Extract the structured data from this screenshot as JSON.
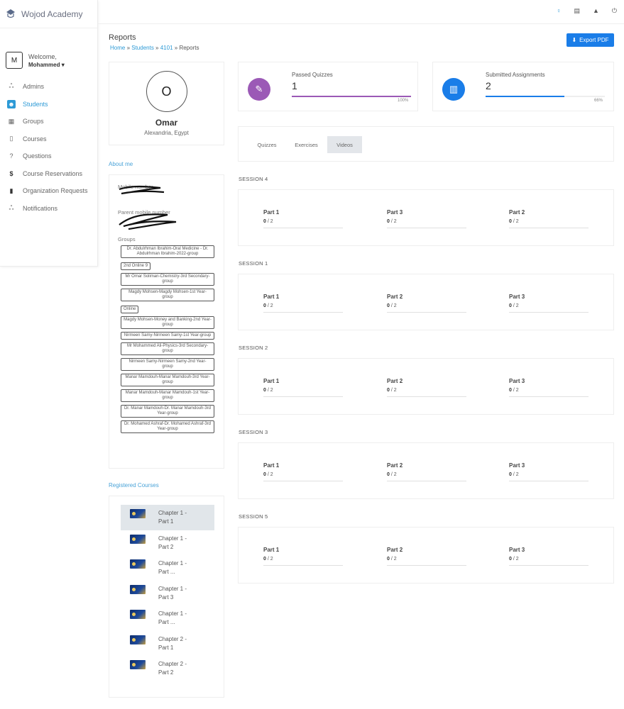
{
  "app": {
    "name": "Wojod Academy",
    "welcome_label": "Welcome,",
    "user_name": "Mohammed",
    "user_initial": "M"
  },
  "sidebar": {
    "items": [
      {
        "label": "Admins",
        "icon": "users-icon"
      },
      {
        "label": "Students",
        "icon": "students-icon",
        "active": true
      },
      {
        "label": "Groups",
        "icon": "grid-icon"
      },
      {
        "label": "Courses",
        "icon": "book-icon"
      },
      {
        "label": "Questions",
        "icon": "question-icon"
      },
      {
        "label": "Course Reservations",
        "icon": "dollar-icon"
      },
      {
        "label": "Organization Requests",
        "icon": "bookmark-icon"
      },
      {
        "label": "Notifications",
        "icon": "users-icon"
      }
    ]
  },
  "header": {
    "title": "Reports",
    "breadcrumb": [
      "Home",
      "Students",
      "4101",
      "Reports"
    ],
    "export_label": "Export PDF"
  },
  "profile": {
    "initial": "O",
    "name": "Omar",
    "location": "Alexandria, Egypt"
  },
  "about": {
    "label": "About me",
    "mobile_label": "Mobile number",
    "parent_label": "Parent mobile number",
    "groups_label": "Groups",
    "groups": [
      "Dr. Abdulrhman Ibrahim-Oral Medicine - Dr. Abdulrhman Ibrahim-2022-group",
      "2nd Online 9",
      "Mr Omar Soliman-Chemistry-3rd Secondary-group",
      "Magdy Mohsen-Magdy Mohsen-1st Year-group",
      "Online",
      "Magdy Mohsen-Money and Banking-2nd Year-group",
      "Nirmeen Samy-Nirmeen Samy-1st Year-group",
      "Mr Mohammed Ali-Physics-3rd Secondary-group",
      "Nirmeen Samy-Nirmeen Samy-2nd Year-group",
      "Manar Mamdouh-Manar Mamdouh-3rd Year-group",
      "Manar Mamdouh-Manar Mamdouh-1st Year-group",
      "Dr. Manar Mamdouh-Dr. Manar Mamdouh-3rd Year-group",
      "Dr. Mohamed Ashraf-Dr. Mohamed Ashraf-3rd Year-group"
    ]
  },
  "courses": {
    "label": "Registered Courses",
    "items": [
      {
        "line1": "Chapter 1 -",
        "line2": "Part 1",
        "active": true
      },
      {
        "line1": "Chapter 1 -",
        "line2": "Part 2"
      },
      {
        "line1": "Chapter 1 -",
        "line2": "Part ..."
      },
      {
        "line1": "Chapter 1 -",
        "line2": "Part 3"
      },
      {
        "line1": "Chapter 1 -",
        "line2": "Part ..."
      },
      {
        "line1": "Chapter 2 -",
        "line2": "Part 1"
      },
      {
        "line1": "Chapter 2 -",
        "line2": "Part 2"
      }
    ]
  },
  "stats": {
    "quizzes": {
      "label": "Passed Quizzes",
      "value": "1",
      "pct_label": "100%",
      "pct": 1.0,
      "color": "#9b59b6"
    },
    "assignments": {
      "label": "Submitted Assignments",
      "value": "2",
      "pct_label": "66%",
      "pct": 0.66,
      "color": "#1a7de8"
    }
  },
  "tabs": [
    {
      "label": "Quizzes"
    },
    {
      "label": "Exercises"
    },
    {
      "label": "Videos",
      "active": true
    }
  ],
  "sessions": [
    {
      "title": "SESSION 4",
      "parts": [
        {
          "name": "Part 1",
          "score": "0",
          "total": "/ 2"
        },
        {
          "name": "Part 3",
          "score": "0",
          "total": "/ 2"
        },
        {
          "name": "Part 2",
          "score": "0",
          "total": "/ 2"
        }
      ]
    },
    {
      "title": "SESSION 1",
      "parts": [
        {
          "name": "Part 1",
          "score": "0",
          "total": "/ 2"
        },
        {
          "name": "Part 2",
          "score": "0",
          "total": "/ 2"
        },
        {
          "name": "Part 3",
          "score": "0",
          "total": "/ 2"
        }
      ]
    },
    {
      "title": "SESSION 2",
      "parts": [
        {
          "name": "Part 1",
          "score": "0",
          "total": "/ 2"
        },
        {
          "name": "Part 2",
          "score": "0",
          "total": "/ 2"
        },
        {
          "name": "Part 3",
          "score": "0",
          "total": "/ 2"
        }
      ]
    },
    {
      "title": "SESSION 3",
      "parts": [
        {
          "name": "Part 1",
          "score": "0",
          "total": "/ 2"
        },
        {
          "name": "Part 2",
          "score": "0",
          "total": "/ 2"
        },
        {
          "name": "Part 3",
          "score": "0",
          "total": "/ 2"
        }
      ]
    },
    {
      "title": "SESSION 5",
      "parts": [
        {
          "name": "Part 1",
          "score": "0",
          "total": "/ 2"
        },
        {
          "name": "Part 2",
          "score": "0",
          "total": "/ 2"
        },
        {
          "name": "Part 3",
          "score": "0",
          "total": "/ 2"
        }
      ]
    }
  ],
  "colors": {
    "accent": "#2d9ad6",
    "button": "#1a7de8"
  }
}
